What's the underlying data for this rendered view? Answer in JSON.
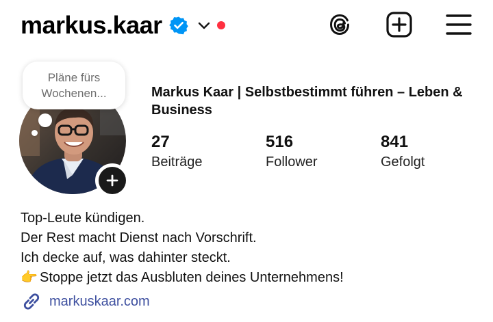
{
  "profile": {
    "username": "markus.kaar",
    "full_name": "Markus Kaar | Selbstbestimmt führen – Leben & Business",
    "verified_color": "#0095f6",
    "notification_dot_color": "#ff3040"
  },
  "header_icons": [
    "threads-icon",
    "create-post-icon",
    "menu-icon"
  ],
  "note": {
    "text": "Pläne fürs\nWochenen..."
  },
  "stats": {
    "posts": {
      "value": "27",
      "label": "Beiträge"
    },
    "followers": {
      "value": "516",
      "label": "Follower"
    },
    "following": {
      "value": "841",
      "label": "Gefolgt"
    }
  },
  "bio": {
    "line1": "Top-Leute kündigen.",
    "line2": "Der Rest macht Dienst nach Vorschrift.",
    "line3": "Ich decke auf, was dahinter steckt.",
    "line4_emoji": "👉",
    "line4": "Stoppe jetzt das Ausbluten deines Unternehmens!"
  },
  "link": {
    "text": "markuskaar.com",
    "color": "#3d4f9f"
  }
}
